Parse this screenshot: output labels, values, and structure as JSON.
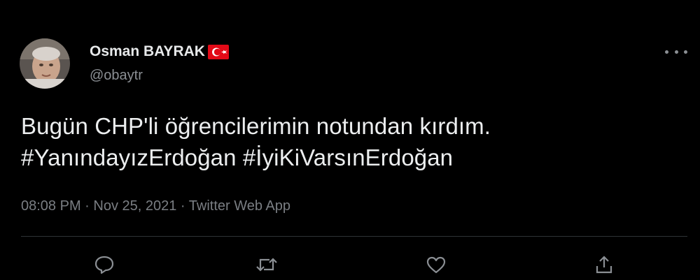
{
  "tweet": {
    "author": {
      "display_name": "Osman BAYRAK",
      "handle": "@obaytr",
      "flag_icon": "turkey-flag-icon"
    },
    "text_lines": [
      "Bugün CHP'li öğrencilerimin notundan kırdım.",
      "#YanındayızErdoğan #İyiKiVarsınErdoğan"
    ],
    "meta": "08:08 PM · Nov 25, 2021 · Twitter Web App",
    "actions": [
      "reply-icon",
      "retweet-icon",
      "like-icon",
      "share-icon"
    ]
  },
  "colors": {
    "background": "#000000",
    "text": "#e7e9ea",
    "secondary": "#7a7e83",
    "flag_red": "#e30a17"
  }
}
